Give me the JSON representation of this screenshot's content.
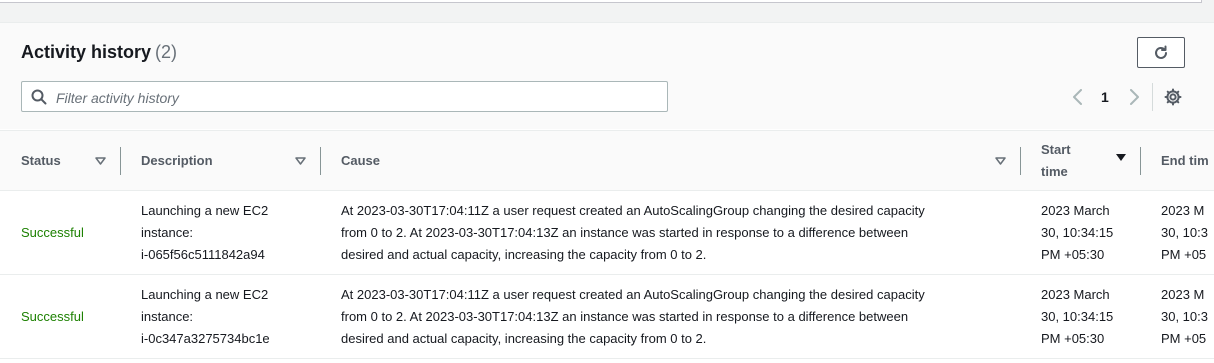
{
  "panel": {
    "title": "Activity history",
    "count": "(2)"
  },
  "search": {
    "placeholder": "Filter activity history"
  },
  "pagination": {
    "current_page": "1"
  },
  "table": {
    "headers": {
      "status": "Status",
      "description": "Description",
      "cause": "Cause",
      "start_time_line1": "Start",
      "start_time_line2": "time",
      "end_time": "End tim"
    },
    "rows": [
      {
        "status": "Successful",
        "description": [
          "Launching a new EC2",
          "instance:",
          "i-065f56c5111842a94"
        ],
        "cause": [
          "At 2023-03-30T17:04:11Z a user request created an AutoScalingGroup changing the desired capacity",
          "from 0 to 2. At 2023-03-30T17:04:13Z an instance was started in response to a difference between",
          "desired and actual capacity, increasing the capacity from 0 to 2."
        ],
        "start_time": [
          "2023 March",
          "30, 10:34:15",
          "PM +05:30"
        ],
        "end_time": [
          "2023 M",
          "30, 10:3",
          "PM +05"
        ]
      },
      {
        "status": "Successful",
        "description": [
          "Launching a new EC2",
          "instance:",
          "i-0c347a3275734bc1e"
        ],
        "cause": [
          "At 2023-03-30T17:04:11Z a user request created an AutoScalingGroup changing the desired capacity",
          "from 0 to 2. At 2023-03-30T17:04:13Z an instance was started in response to a difference between",
          "desired and actual capacity, increasing the capacity from 0 to 2."
        ],
        "start_time": [
          "2023 March",
          "30, 10:34:15",
          "PM +05:30"
        ],
        "end_time": [
          "2023 M",
          "30, 10:3",
          "PM +05"
        ]
      }
    ]
  },
  "colors": {
    "success": "#1d8102",
    "header_text": "#545b64",
    "title_text": "#16191f"
  }
}
